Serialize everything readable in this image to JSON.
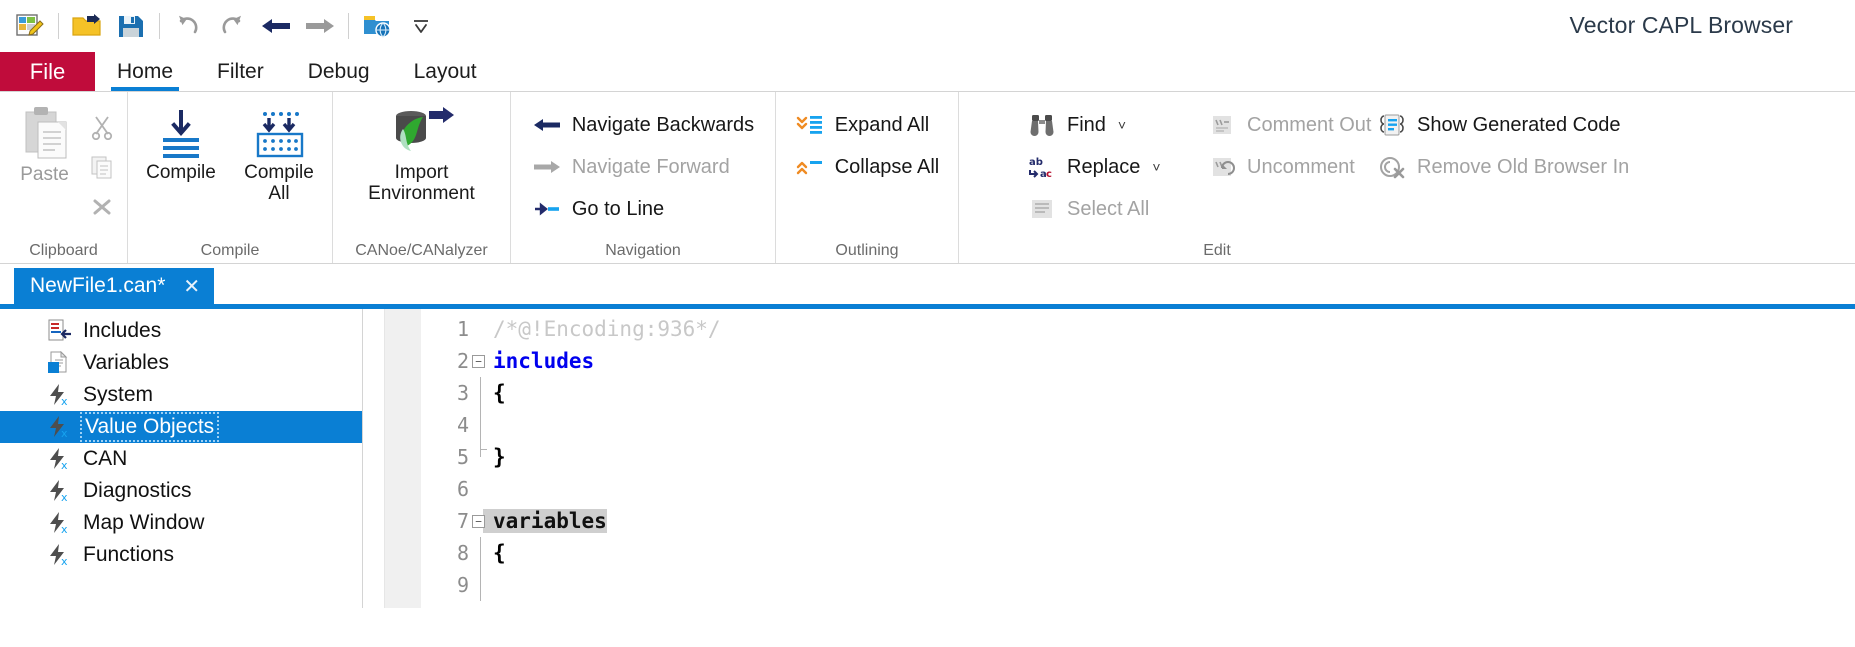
{
  "window": {
    "title": "Vector CAPL Browser"
  },
  "quick_access": [
    {
      "name": "new-file-icon",
      "label": "New"
    },
    {
      "name": "open-folder-icon",
      "label": "Open"
    },
    {
      "name": "save-icon",
      "label": "Save"
    },
    {
      "name": "undo-icon",
      "label": "Undo"
    },
    {
      "name": "redo-icon",
      "label": "Redo"
    },
    {
      "name": "back-arrow-icon",
      "label": "Back"
    },
    {
      "name": "forward-arrow-icon",
      "label": "Forward"
    },
    {
      "name": "browse-environment-icon",
      "label": "Browse"
    },
    {
      "name": "customize-qat-icon",
      "label": "Customize Quick Access Toolbar"
    }
  ],
  "ribbon": {
    "tabs": [
      {
        "label": "File",
        "active": false,
        "style": "file"
      },
      {
        "label": "Home",
        "active": true
      },
      {
        "label": "Filter",
        "active": false
      },
      {
        "label": "Debug",
        "active": false
      },
      {
        "label": "Layout",
        "active": false
      }
    ],
    "groups": {
      "clipboard": {
        "label": "Clipboard",
        "paste": "Paste",
        "cut_icon": "cut-icon",
        "copy_icon": "copy-icon",
        "delete_icon": "delete-icon"
      },
      "compile": {
        "label": "Compile",
        "compile": "Compile",
        "compile_all": "Compile\nAll",
        "compile_all_line1": "Compile",
        "compile_all_line2": "All"
      },
      "canoe": {
        "label": "CANoe/CANalyzer",
        "import_line1": "Import",
        "import_line2": "Environment"
      },
      "navigation": {
        "label": "Navigation",
        "items": [
          {
            "label": "Navigate Backwards",
            "icon": "arrow-left-icon",
            "disabled": false
          },
          {
            "label": "Navigate Forward",
            "icon": "arrow-right-icon",
            "disabled": true
          },
          {
            "label": "Go to Line",
            "icon": "goto-line-icon",
            "disabled": false
          }
        ]
      },
      "outlining": {
        "label": "Outlining",
        "items": [
          {
            "label": "Expand All",
            "icon": "expand-all-icon",
            "disabled": false
          },
          {
            "label": "Collapse All",
            "icon": "collapse-all-icon",
            "disabled": false
          }
        ]
      },
      "edit": {
        "label": "Edit",
        "col1": [
          {
            "label": "Find",
            "icon": "binoculars-icon",
            "disabled": false,
            "dropdown": true
          },
          {
            "label": "Replace",
            "icon": "replace-icon",
            "disabled": false,
            "dropdown": true
          },
          {
            "label": "Select All",
            "icon": "select-all-icon",
            "disabled": true,
            "dropdown": false
          }
        ],
        "col2": [
          {
            "label": "Comment Out",
            "icon": "comment-out-icon",
            "disabled": true
          },
          {
            "label": "Uncomment",
            "icon": "uncomment-icon",
            "disabled": true
          }
        ],
        "col3": [
          {
            "label": "Show Generated Code",
            "icon": "show-generated-code-icon",
            "disabled": false
          },
          {
            "label": "Remove Old Browser In",
            "icon": "remove-old-browser-icon",
            "disabled": true
          }
        ]
      }
    }
  },
  "document_tabs": [
    {
      "label": "NewFile1.can*",
      "close": "✕",
      "active": true
    }
  ],
  "tree": {
    "items": [
      {
        "label": "Includes",
        "icon": "includes-icon",
        "selected": false
      },
      {
        "label": "Variables",
        "icon": "variables-icon",
        "selected": false
      },
      {
        "label": "System",
        "icon": "event-icon",
        "selected": false
      },
      {
        "label": "Value Objects",
        "icon": "event-icon",
        "selected": true
      },
      {
        "label": "CAN",
        "icon": "event-icon",
        "selected": false
      },
      {
        "label": "Diagnostics",
        "icon": "event-icon",
        "selected": false
      },
      {
        "label": "Map Window",
        "icon": "event-icon",
        "selected": false
      },
      {
        "label": "Functions",
        "icon": "event-icon",
        "selected": false
      }
    ]
  },
  "editor": {
    "lines": [
      {
        "num": "1",
        "text": "/*@!Encoding:936*/",
        "style": "comment",
        "fold": "",
        "guide": "none"
      },
      {
        "num": "2",
        "text": "includes",
        "style": "keyword-blue",
        "fold": "−",
        "guide": "none"
      },
      {
        "num": "3",
        "text": "{",
        "style": "plain",
        "fold": "",
        "guide": "mid"
      },
      {
        "num": "4",
        "text": "",
        "style": "plain",
        "fold": "",
        "guide": "mid"
      },
      {
        "num": "5",
        "text": "}",
        "style": "plain",
        "fold": "",
        "guide": "end"
      },
      {
        "num": "6",
        "text": "",
        "style": "plain",
        "fold": "",
        "guide": "none"
      },
      {
        "num": "7",
        "text": "variables",
        "style": "selected",
        "fold": "−",
        "guide": "none"
      },
      {
        "num": "8",
        "text": "{",
        "style": "plain",
        "fold": "",
        "guide": "mid"
      },
      {
        "num": "9",
        "text": "",
        "style": "plain",
        "fold": "",
        "guide": "mid"
      }
    ]
  },
  "colors": {
    "accent_blue": "#0a7fd4",
    "file_tab_red": "#c00c3b",
    "orange": "#ef8b22",
    "keyword_blue": "#0000ee",
    "comment_gray": "#c8c8c8",
    "selection_gray": "#cfcfcf"
  }
}
